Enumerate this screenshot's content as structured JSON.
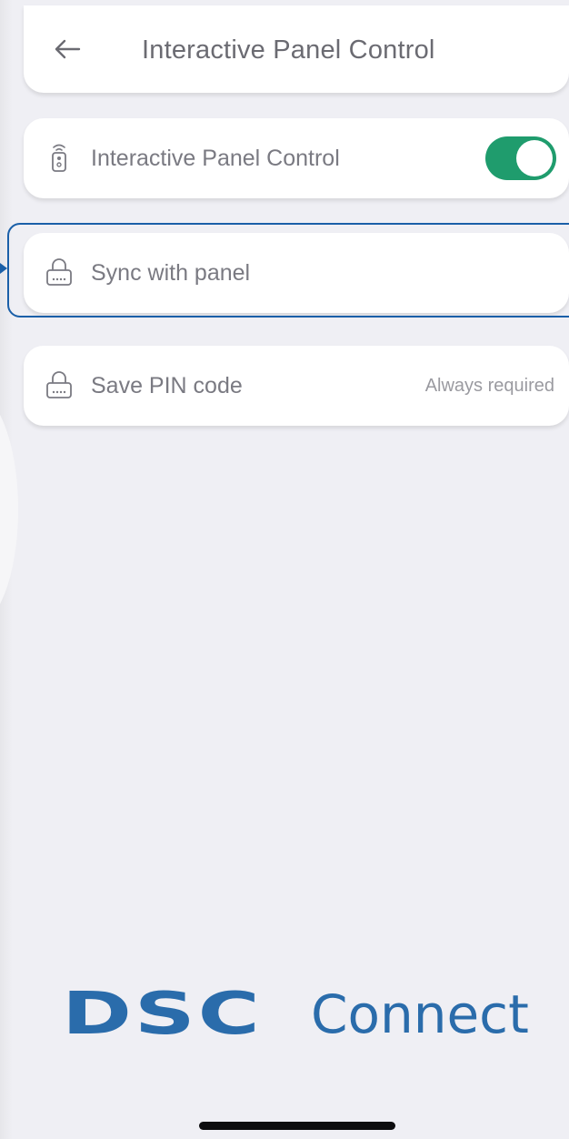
{
  "header": {
    "title": "Interactive Panel Control",
    "back_icon": "arrow-left-icon"
  },
  "rows": [
    {
      "label": "Interactive Panel Control",
      "icon": "remote-icon",
      "control": "toggle",
      "toggle_on": true
    },
    {
      "label": "Sync with panel",
      "icon": "keypad-lock-icon"
    },
    {
      "label": "Save PIN code",
      "icon": "keypad-lock-icon",
      "value": "Always required"
    }
  ],
  "brand": {
    "dsc": "DSC",
    "connect": "Connect"
  },
  "colors": {
    "background": "#efeff4",
    "toggle_on": "#1f9c6d",
    "brand": "#2a6cab",
    "highlight": "#1a5fa8",
    "text": "#7a7a82"
  }
}
